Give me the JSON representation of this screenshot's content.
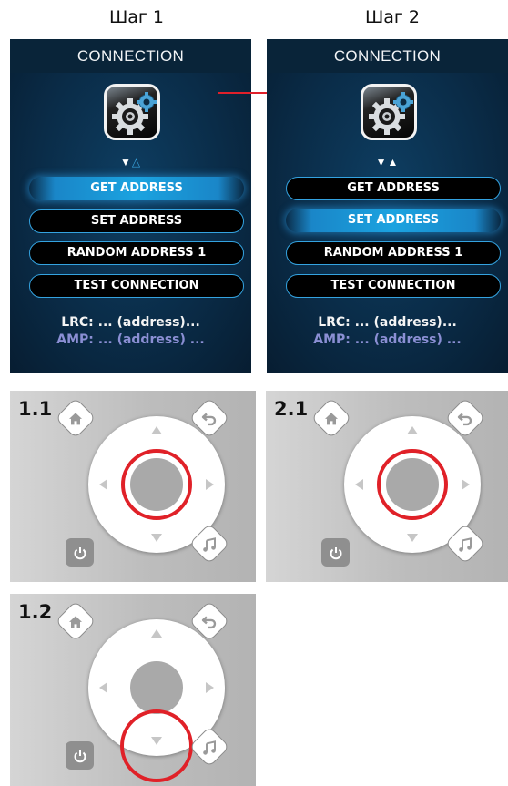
{
  "steps": {
    "step1_label": "Шаг 1",
    "step2_label": "Шаг 2"
  },
  "screen1": {
    "title": "CONNECTION",
    "arrows": "▼△",
    "buttons": [
      "GET ADDRESS",
      "SET ADDRESS",
      "RANDOM ADDRESS 1",
      "TEST CONNECTION"
    ],
    "active_index": 0,
    "lrc": "LRC: ... (address)...",
    "amp": "AMP: ... (address) ..."
  },
  "screen2": {
    "title": "CONNECTION",
    "arrows": "▼▲",
    "buttons": [
      "GET ADDRESS",
      "SET ADDRESS",
      "RANDOM ADDRESS 1",
      "TEST CONNECTION"
    ],
    "active_index": 1,
    "lrc": "LRC: ... (address)...",
    "amp": "AMP: ... (address) ..."
  },
  "remotes": {
    "r11_label": "1.1",
    "r21_label": "2.1",
    "r12_label": "1.2",
    "r11_highlight": "center-button",
    "r21_highlight": "center-button",
    "r12_highlight": "down-arrow"
  },
  "icons": {
    "settings": "gear-icon",
    "home": "home-icon",
    "back": "back-icon",
    "music": "music-note-icon",
    "power": "power-icon"
  },
  "colors": {
    "screen_bg": "#0a2c48",
    "button_border": "#34a3e0",
    "button_active": "#1ba3e0",
    "amp_text": "#8b8fd4",
    "highlight_ring": "#e02128",
    "remote_bg": "#c4c4c4"
  }
}
